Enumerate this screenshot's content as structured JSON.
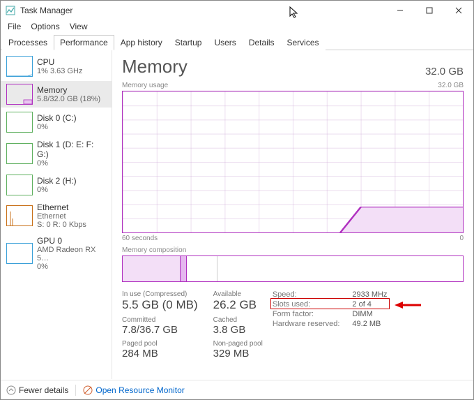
{
  "window": {
    "title": "Task Manager"
  },
  "menus": [
    "File",
    "Options",
    "View"
  ],
  "tabs": [
    "Processes",
    "Performance",
    "App history",
    "Startup",
    "Users",
    "Details",
    "Services"
  ],
  "active_tab": "Performance",
  "sidebar": {
    "items": [
      {
        "name": "CPU",
        "sub": "1% 3.63 GHz",
        "color": "#3aa0d8"
      },
      {
        "name": "Memory",
        "sub": "5.8/32.0 GB (18%)",
        "color": "#b030c0",
        "selected": true
      },
      {
        "name": "Disk 0 (C:)",
        "sub": "0%",
        "color": "#5fb05f"
      },
      {
        "name": "Disk 1 (D: E: F: G:)",
        "sub": "0%",
        "color": "#5fb05f"
      },
      {
        "name": "Disk 2 (H:)",
        "sub": "0%",
        "color": "#5fb05f"
      },
      {
        "name": "Ethernet",
        "sub": "Ethernet",
        "sub2": "S: 0 R: 0 Kbps",
        "color": "#c87018"
      },
      {
        "name": "GPU 0",
        "sub": "AMD Radeon RX 5…",
        "sub2": "0%",
        "color": "#3aa0d8"
      }
    ]
  },
  "main": {
    "title": "Memory",
    "capacity": "32.0 GB",
    "usage_chart": {
      "label_left": "Memory usage",
      "label_right": "32.0 GB",
      "x_left": "60 seconds",
      "x_right": "0"
    },
    "composition_label": "Memory composition",
    "stats": {
      "in_use_label": "In use (Compressed)",
      "in_use": "5.5 GB (0 MB)",
      "available_label": "Available",
      "available": "26.2 GB",
      "committed_label": "Committed",
      "committed": "7.8/36.7 GB",
      "cached_label": "Cached",
      "cached": "3.8 GB",
      "paged_label": "Paged pool",
      "paged": "284 MB",
      "nonpaged_label": "Non-paged pool",
      "nonpaged": "329 MB"
    },
    "hw": {
      "speed_label": "Speed:",
      "speed": "2933 MHz",
      "slots_label": "Slots used:",
      "slots": "2 of 4",
      "form_label": "Form factor:",
      "form": "DIMM",
      "reserved_label": "Hardware reserved:",
      "reserved": "49.2 MB"
    }
  },
  "footer": {
    "fewer": "Fewer details",
    "orm": "Open Resource Monitor"
  },
  "chart_data": {
    "type": "area",
    "title": "Memory usage",
    "ylabel": "GB",
    "ylim": [
      0,
      32
    ],
    "x": [
      60,
      50,
      40,
      30,
      20,
      16,
      10,
      0
    ],
    "values": [
      0,
      0,
      0,
      0,
      0,
      0,
      5.8,
      5.8
    ],
    "xlabel": "seconds"
  }
}
